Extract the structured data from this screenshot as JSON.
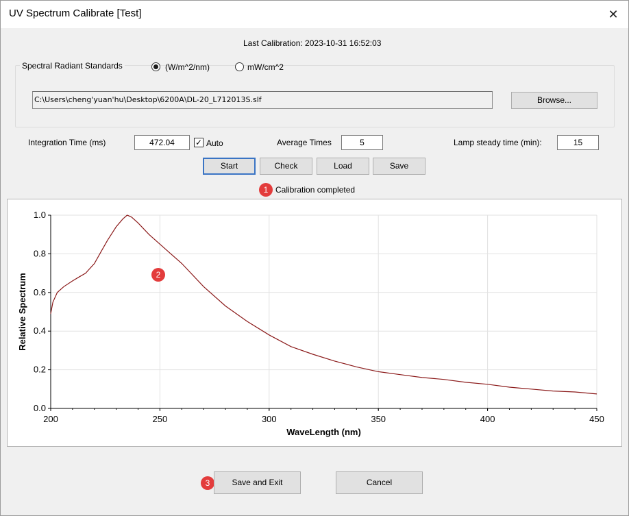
{
  "window": {
    "title": "UV Spectrum Calibrate [Test]",
    "close_glyph": "✕"
  },
  "header": {
    "last_calibration": "Last Calibration: 2023-10-31 16:52:03"
  },
  "standards": {
    "label": "Spectral Radiant Standards",
    "options": [
      {
        "label": "(W/m^2/nm)",
        "selected": true
      },
      {
        "label": "mW/cm^2",
        "selected": false
      }
    ],
    "file_path": "C:\\Users\\cheng'yuan'hu\\Desktop\\6200A\\DL-20_L712013S.slf",
    "browse_label": "Browse..."
  },
  "settings": {
    "integration_label": "Integration Time (ms)",
    "integration_value": "472.04",
    "auto_label": "Auto",
    "auto_checked": true,
    "average_label": "Average Times",
    "average_value": "5",
    "lamp_label": "Lamp steady time (min):",
    "lamp_value": "15"
  },
  "actions": {
    "start": "Start",
    "check": "Check",
    "load": "Load",
    "save": "Save"
  },
  "status": {
    "text": "Calibration completed"
  },
  "markers": [
    "1",
    "2",
    "3"
  ],
  "footer": {
    "save_exit": "Save and Exit",
    "cancel": "Cancel"
  },
  "chart_data": {
    "type": "line",
    "xlabel": "WaveLength (nm)",
    "ylabel": "Relative Spectrum",
    "xlim": [
      200,
      450
    ],
    "ylim": [
      0,
      1.0
    ],
    "xticks": [
      200,
      250,
      300,
      350,
      400,
      450
    ],
    "yticks": [
      0.0,
      0.2,
      0.4,
      0.6,
      0.8,
      1.0
    ],
    "yticklabels": [
      "0.0",
      "0.2",
      "0.4",
      "0.6",
      "0.8",
      "1.0"
    ],
    "grid": true,
    "line_color": "#8b1a1a",
    "series": [
      {
        "x": [
          200,
          201,
          203,
          206,
          210,
          213,
          216,
          220,
          223,
          226,
          230,
          233,
          235,
          237,
          240,
          245,
          250,
          255,
          260,
          270,
          280,
          290,
          300,
          310,
          320,
          330,
          340,
          350,
          360,
          370,
          380,
          390,
          400,
          410,
          420,
          430,
          440,
          450
        ],
        "y": [
          0.49,
          0.55,
          0.6,
          0.63,
          0.66,
          0.68,
          0.7,
          0.75,
          0.81,
          0.87,
          0.94,
          0.98,
          1.0,
          0.99,
          0.96,
          0.9,
          0.85,
          0.8,
          0.75,
          0.63,
          0.53,
          0.45,
          0.38,
          0.32,
          0.28,
          0.245,
          0.215,
          0.19,
          0.175,
          0.16,
          0.15,
          0.135,
          0.125,
          0.11,
          0.1,
          0.09,
          0.085,
          0.075
        ]
      }
    ]
  }
}
